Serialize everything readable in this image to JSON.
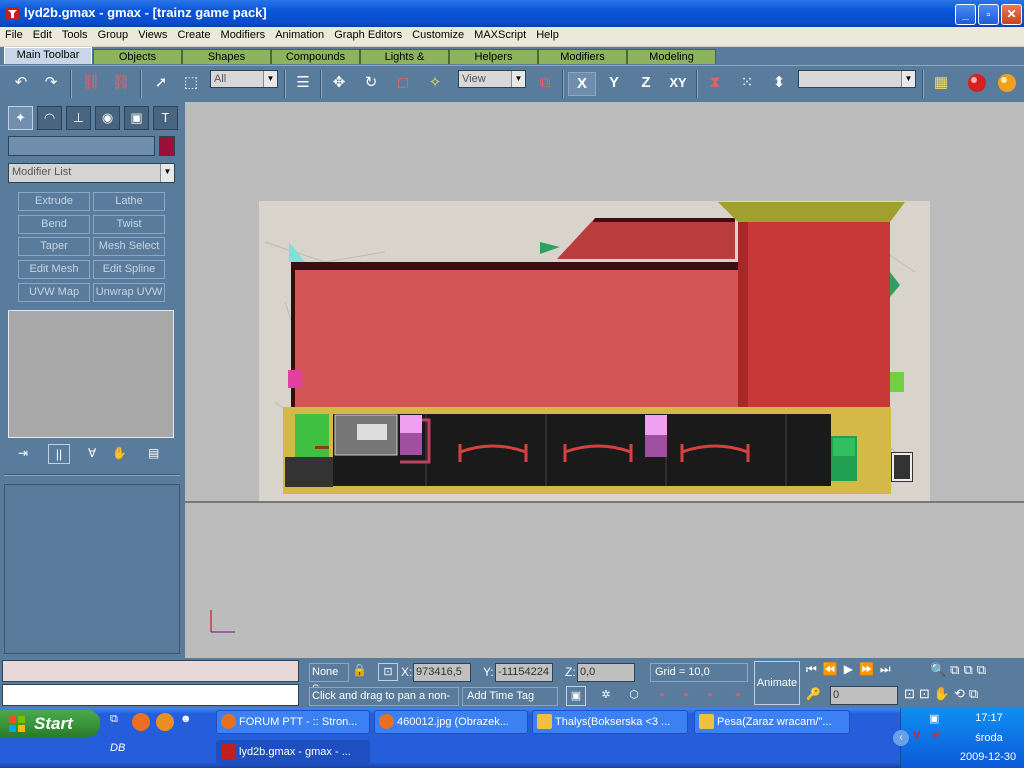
{
  "window": {
    "title": "lyd2b.gmax - gmax - [trainz game pack]",
    "min": "_",
    "max": "▫",
    "close": "✕"
  },
  "menu": [
    "File",
    "Edit",
    "Tools",
    "Group",
    "Views",
    "Create",
    "Modifiers",
    "Animation",
    "Graph Editors",
    "Customize",
    "MAXScript",
    "Help"
  ],
  "tabs": [
    "Main Toolbar",
    "Objects",
    "Shapes",
    "Compounds",
    "Lights & Cameras",
    "Helpers",
    "Modifiers",
    "Modeling"
  ],
  "toolbar": {
    "selection_filter": "All",
    "ref_coord": "View",
    "axis_x": "X",
    "axis_y": "Y",
    "axis_z": "Z",
    "axis_xy": "XY"
  },
  "command_panel": {
    "modifier_list": "Modifier List",
    "buttons": [
      "Extrude",
      "Lathe",
      "Bend",
      "Twist",
      "Taper",
      "Mesh Select",
      "Edit Mesh",
      "Edit Spline",
      "UVW Map",
      "Unwrap UVW"
    ],
    "name_color": "#9a1038"
  },
  "status": {
    "selection": "None S",
    "x_label": "X:",
    "x_value": "973416,5",
    "y_label": "Y:",
    "y_value": "-11154224",
    "z_label": "Z:",
    "z_value": "0,0",
    "grid": "Grid = 10,0",
    "prompt": "Click and drag to pan a non-ca",
    "add_time_tag": "Add Time Tag",
    "animate": "Animate",
    "frame": "0"
  },
  "taskbar": {
    "start": "Start",
    "tasks": [
      "FORUM PTT - :: Stron...",
      "460012.jpg (Obrazek...",
      "Thalys(Bokserska <3 ...",
      "Pesa(Zaraz wracam/\"...",
      "lyd2b.gmax - gmax - ..."
    ],
    "time": "17:17",
    "day": "środa",
    "date": "2009-12-30"
  },
  "colors": {
    "accent": "#245edb",
    "panel": "#5a7c9c",
    "body_red": "#cf5050",
    "frame_yellow": "#d4b848",
    "tab_green": "#8eb35d"
  }
}
